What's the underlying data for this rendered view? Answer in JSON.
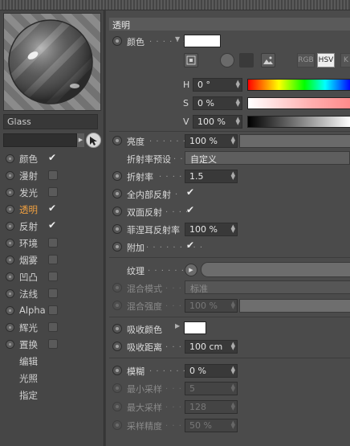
{
  "material_name": "Glass",
  "channels": [
    {
      "label": "颜色",
      "checked": true
    },
    {
      "label": "漫射",
      "checked": false
    },
    {
      "label": "发光",
      "checked": false
    },
    {
      "label": "透明",
      "checked": true
    },
    {
      "label": "反射",
      "checked": true
    },
    {
      "label": "环境",
      "checked": false
    },
    {
      "label": "烟雾",
      "checked": false
    },
    {
      "label": "凹凸",
      "checked": false
    },
    {
      "label": "法线",
      "checked": false
    },
    {
      "label": "Alpha",
      "checked": false
    },
    {
      "label": "辉光",
      "checked": false
    },
    {
      "label": "置换",
      "checked": false
    }
  ],
  "sub_items": [
    "编辑",
    "光照",
    "指定"
  ],
  "section_title": "透明",
  "color": {
    "label": "颜色",
    "dots": ". . . . . .",
    "swatch_color": "#ffffff",
    "modes": [
      "RGB",
      "HSV",
      "K"
    ],
    "active_mode": "HSV",
    "h_label": "H",
    "h_value": "0 °",
    "s_label": "S",
    "s_value": "0 %",
    "v_label": "V",
    "v_value": "100 %"
  },
  "brightness": {
    "label": "亮度",
    "dots": ". . . . . . .",
    "value": "100 %"
  },
  "ior_preset": {
    "label": "折射率预设",
    "dots": ". .",
    "value": "自定义"
  },
  "ior": {
    "label": "折射率",
    "dots": ". . . . .",
    "value": "1.5"
  },
  "total_internal": {
    "label": "全内部反射",
    "dots": ".",
    "checked": true
  },
  "double_sided": {
    "label": "双面反射",
    "dots": ". . . .",
    "checked": true
  },
  "fresnel": {
    "label": "菲涅耳反射率",
    "value": "100 %"
  },
  "additive": {
    "label": "附加",
    "dots": ". . . . . . . . .",
    "checked": true
  },
  "texture": {
    "label": "纹理",
    "dots": ". . . . . . . ."
  },
  "mix_mode": {
    "label": "混合模式",
    "dots": ". . . .",
    "value": "标准"
  },
  "mix_strength": {
    "label": "混合强度",
    "dots": ". . . .",
    "value": "100 %"
  },
  "absorption_color": {
    "label": "吸收颜色",
    "swatch_color": "#ffffff"
  },
  "absorption_distance": {
    "label": "吸收距离",
    "dots": ". . . .",
    "value": "100 cm"
  },
  "blur": {
    "label": "模糊",
    "dots": ". . . . . . .",
    "value": "0 %"
  },
  "min_samples": {
    "label": "最小采样",
    "dots": ". . . .",
    "value": "5"
  },
  "max_samples": {
    "label": "最大采样",
    "dots": ". . . .",
    "value": "128"
  },
  "sample_accuracy": {
    "label": "采样精度",
    "dots": ". . . .",
    "value": "50 %"
  }
}
